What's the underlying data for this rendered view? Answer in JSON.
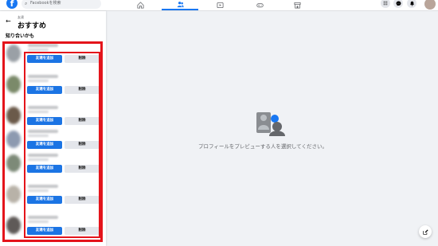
{
  "topbar": {
    "search_placeholder": "Facebookを検索"
  },
  "sidebar": {
    "breadcrumb": "友達",
    "title": "おすすめ",
    "section_title": "知り合いかも",
    "suggestions": [
      {
        "add_label": "友達を追加",
        "remove_label": "削除"
      },
      {
        "add_label": "友達を追加",
        "remove_label": "削除"
      },
      {
        "add_label": "友達を追加",
        "remove_label": "削除"
      },
      {
        "add_label": "友達を追加",
        "remove_label": "削除"
      },
      {
        "add_label": "友達を追加",
        "remove_label": "削除"
      },
      {
        "add_label": "友達を追加",
        "remove_label": "削除"
      },
      {
        "add_label": "友達を追加",
        "remove_label": "削除"
      }
    ]
  },
  "main": {
    "empty_message": "プロフィールをプレビューする人を選択してください。"
  },
  "colors": {
    "brand": "#1877f2",
    "add_button": "#1b74e4",
    "highlight": "#e4141b"
  },
  "icons": [
    "facebook-logo",
    "search-icon",
    "home-icon",
    "friends-icon",
    "watch-icon",
    "gaming-icon",
    "marketplace-icon",
    "menu-grid-icon",
    "messenger-icon",
    "notifications-icon",
    "back-arrow-icon",
    "compose-icon"
  ]
}
